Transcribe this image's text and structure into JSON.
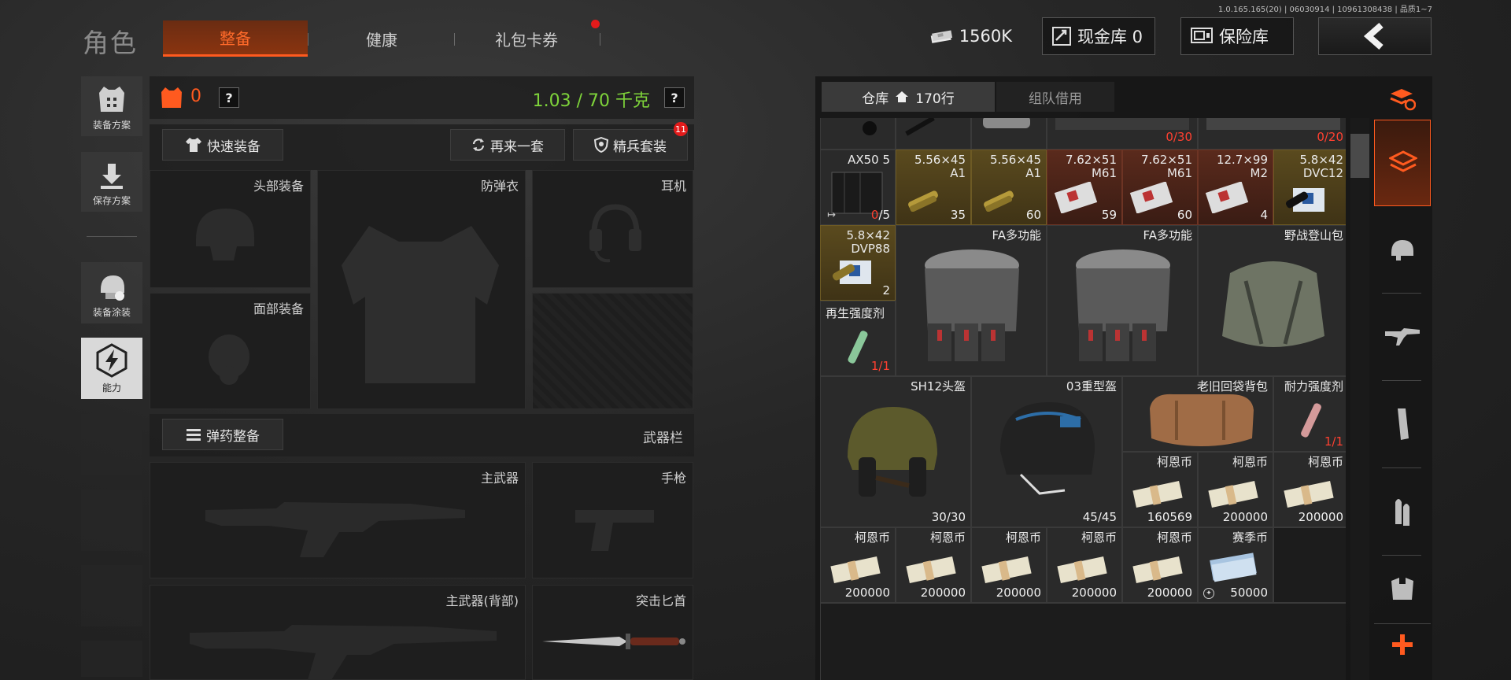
{
  "version": "1.0.165.165(20) | 06030914 | 10961308438 | 品质1~7",
  "header": {
    "title": "角色",
    "tabs": [
      {
        "label": "整备",
        "active": true
      },
      {
        "label": "健康",
        "active": false
      },
      {
        "label": "礼包卡券",
        "active": false,
        "badge_dot": true
      }
    ],
    "money": "1560K",
    "cash_vault": "现金库 0",
    "safe_box": "保险库"
  },
  "left_nav": [
    {
      "label": "装备方案",
      "icon": "vest-grid-icon"
    },
    {
      "label": "保存方案",
      "icon": "download-icon"
    },
    {
      "label": "装备涂装",
      "icon": "helmet-paint-icon"
    },
    {
      "label": "能力",
      "icon": "lightning-hex-icon"
    }
  ],
  "equip": {
    "armor_count": "0",
    "weight": "1.03 / 70 千克",
    "quick_equip": "快速装备",
    "retry_set": "再来一套",
    "elite_set": "精兵套装",
    "elite_badge": "11",
    "slots": {
      "head": "头部装备",
      "vest": "防弹衣",
      "headset": "耳机",
      "face": "面部装备",
      "ammo_btn": "弹药整备",
      "weapon_bar": "武器栏",
      "primary": "主武器",
      "pistol": "手枪",
      "primary_back": "主武器(背部)",
      "knife": "突击匕首"
    }
  },
  "warehouse": {
    "tab_label": "仓库",
    "rows": "170行",
    "team_borrow": "组队借用",
    "top_counts": [
      "0/30",
      "0/20"
    ],
    "items": {
      "ax50": {
        "name": "AX50 5",
        "count": "0/5"
      },
      "a1_35": {
        "name": "5.56×45\nA1",
        "count": "35"
      },
      "a1_60": {
        "name": "5.56×45\nA1",
        "count": "60"
      },
      "m61_59": {
        "name": "7.62×51\nM61",
        "count": "59"
      },
      "m61_60": {
        "name": "7.62×51\nM61",
        "count": "60"
      },
      "m2": {
        "name": "12.7×99\nM2",
        "count": "4"
      },
      "dvc12": {
        "name": "5.8×42\nDVC12",
        "count": ""
      },
      "dvp88": {
        "name": "5.8×42\nDVP88",
        "count": "2"
      },
      "fa1": {
        "name": "FA多功能"
      },
      "fa2": {
        "name": "FA多功能"
      },
      "field_bag": {
        "name": "野战登山包"
      },
      "regen": {
        "name": "再生强度剂",
        "count": "1/1"
      },
      "sh12": {
        "name": "SH12头盔",
        "count": "30/30"
      },
      "heavy03": {
        "name": "03重型盔",
        "count": "45/45"
      },
      "old_bag": {
        "name": "老旧回袋背包"
      },
      "endure": {
        "name": "耐力强度剂",
        "count": "1/1"
      },
      "coin_160569": {
        "name": "柯恩币",
        "count": "160569"
      },
      "coin_a": {
        "name": "柯恩币",
        "count": "200000"
      },
      "coin_b": {
        "name": "柯恩币",
        "count": "200000"
      },
      "coin_r1": {
        "name": "柯恩币",
        "count": "200000"
      },
      "coin_r2": {
        "name": "柯恩币",
        "count": "200000"
      },
      "coin_r3": {
        "name": "柯恩币",
        "count": "200000"
      },
      "coin_r4": {
        "name": "柯恩币",
        "count": "200000"
      },
      "coin_r5": {
        "name": "柯恩币",
        "count": "200000"
      },
      "season": {
        "name": "赛季币",
        "count": "50000"
      }
    }
  },
  "colors": {
    "accent": "#ff5a1f",
    "weight_green": "#7ed33a",
    "ammo_gold": "#5a4a1e"
  }
}
